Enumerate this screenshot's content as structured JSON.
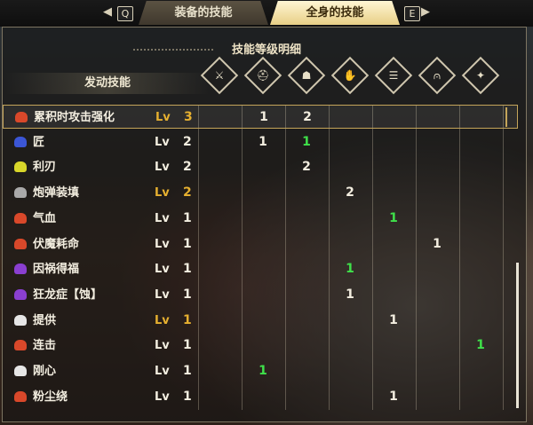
{
  "tabs": {
    "left_key": "Q",
    "right_key": "E",
    "equipped_label": "装备的技能",
    "full_label": "全身的技能"
  },
  "panel": {
    "title": "技能等级明细",
    "active_skills_label": "发动技能"
  },
  "equipment_slots": [
    {
      "name": "weapon-icon",
      "glyph": "⚔"
    },
    {
      "name": "helmet-icon",
      "glyph": "⛑"
    },
    {
      "name": "chest-icon",
      "glyph": "☗"
    },
    {
      "name": "arms-icon",
      "glyph": "✋"
    },
    {
      "name": "waist-icon",
      "glyph": "☰"
    },
    {
      "name": "legs-icon",
      "glyph": "⩀"
    },
    {
      "name": "talisman-icon",
      "glyph": "✦"
    }
  ],
  "level_prefix": "Lv",
  "colors": {
    "max_level": "#e6b030",
    "normal_level": "#f3eee0",
    "green_value": "#3fe04a",
    "white_value": "#f3eee0"
  },
  "skills": [
    {
      "name": "累积时攻击强化",
      "level": "3",
      "max": true,
      "icon_color": "#d9482a",
      "cells": [
        "",
        "1",
        "2",
        "",
        "",
        "",
        ""
      ],
      "green": [
        false,
        false,
        false,
        false,
        false,
        false,
        false
      ]
    },
    {
      "name": "匠",
      "level": "2",
      "max": false,
      "icon_color": "#3b56d6",
      "cells": [
        "",
        "1",
        "1",
        "",
        "",
        "",
        ""
      ],
      "green": [
        false,
        false,
        true,
        false,
        false,
        false,
        false
      ]
    },
    {
      "name": "利刃",
      "level": "2",
      "max": false,
      "icon_color": "#d8d62a",
      "cells": [
        "",
        "",
        "2",
        "",
        "",
        "",
        ""
      ],
      "green": [
        false,
        false,
        false,
        false,
        false,
        false,
        false
      ]
    },
    {
      "name": "炮弹装填",
      "level": "2",
      "max": true,
      "icon_color": "#a9a9a9",
      "cells": [
        "",
        "",
        "",
        "2",
        "",
        "",
        ""
      ],
      "green": [
        false,
        false,
        false,
        false,
        false,
        false,
        false
      ]
    },
    {
      "name": "气血",
      "level": "1",
      "max": false,
      "icon_color": "#d9482a",
      "cells": [
        "",
        "",
        "",
        "",
        "1",
        "",
        ""
      ],
      "green": [
        false,
        false,
        false,
        false,
        true,
        false,
        false
      ]
    },
    {
      "name": "伏魔耗命",
      "level": "1",
      "max": false,
      "icon_color": "#d9482a",
      "cells": [
        "",
        "",
        "",
        "",
        "",
        "1",
        ""
      ],
      "green": [
        false,
        false,
        false,
        false,
        false,
        false,
        false
      ]
    },
    {
      "name": "因祸得福",
      "level": "1",
      "max": false,
      "icon_color": "#8a3fd0",
      "cells": [
        "",
        "",
        "",
        "1",
        "",
        "",
        ""
      ],
      "green": [
        false,
        false,
        false,
        true,
        false,
        false,
        false
      ]
    },
    {
      "name": "狂龙症【蚀】",
      "level": "1",
      "max": false,
      "icon_color": "#8a3fd0",
      "cells": [
        "",
        "",
        "",
        "1",
        "",
        "",
        ""
      ],
      "green": [
        false,
        false,
        false,
        false,
        false,
        false,
        false
      ]
    },
    {
      "name": "提供",
      "level": "1",
      "max": true,
      "icon_color": "#e6e6e6",
      "cells": [
        "",
        "",
        "",
        "",
        "1",
        "",
        ""
      ],
      "green": [
        false,
        false,
        false,
        false,
        false,
        false,
        false
      ]
    },
    {
      "name": "连击",
      "level": "1",
      "max": false,
      "icon_color": "#d9482a",
      "cells": [
        "",
        "",
        "",
        "",
        "",
        "",
        "1"
      ],
      "green": [
        false,
        false,
        false,
        false,
        false,
        false,
        true
      ]
    },
    {
      "name": "刚心",
      "level": "1",
      "max": false,
      "icon_color": "#e6e6e6",
      "cells": [
        "",
        "1",
        "",
        "",
        "",
        "",
        ""
      ],
      "green": [
        false,
        true,
        false,
        false,
        false,
        false,
        false
      ]
    },
    {
      "name": "粉尘绕",
      "level": "1",
      "max": false,
      "icon_color": "#d9482a",
      "cells": [
        "",
        "",
        "",
        "",
        "1",
        "",
        ""
      ],
      "green": [
        false,
        false,
        false,
        false,
        false,
        false,
        false
      ]
    }
  ]
}
